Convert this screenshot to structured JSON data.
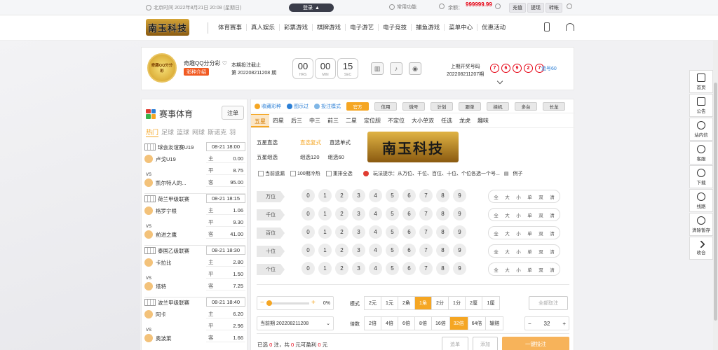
{
  "topbar": {
    "time": "北京时间 2022年8月21日 20:08 (星期日)",
    "login": "登录",
    "common_functions": "常用功能",
    "balance_label": "余额：",
    "balance_value": "999999.99",
    "btn_recharge": "充值",
    "btn_withdraw": "提现",
    "btn_transfer": "转帐"
  },
  "nav": {
    "logo": "南玉科技",
    "menu": [
      "体育赛事",
      "真人娱乐",
      "彩票游戏",
      "棋牌游戏",
      "电子游艺",
      "电子竞技",
      "捕鱼游戏",
      "菜单中心",
      "优惠活动"
    ]
  },
  "game": {
    "logo_text": "奇趣QQ分分彩",
    "name": "奇趣QQ分分彩",
    "intro_btn": "彩种介绍",
    "deadline_label": "本期投注截止",
    "period": "第 202208211208 期",
    "timers": [
      {
        "value": "00",
        "label": "HRS"
      },
      {
        "value": "00",
        "label": "MIN"
      },
      {
        "value": "15",
        "label": "SEC"
      }
    ],
    "last_label": "上期开奖号码",
    "last_period": "202208211207期",
    "last_numbers": [
      "7",
      "6",
      "9",
      "2",
      "7"
    ],
    "track": "追号60"
  },
  "sports": {
    "title": "赛事体育",
    "bet_btn": "注单",
    "tabs": [
      "热门",
      "足球",
      "篮球",
      "网球",
      "斯诺克",
      "羽"
    ],
    "vs": "VS",
    "matches": [
      {
        "league": "球会友谊赛U19",
        "time": "08-21 18:00",
        "home": "卢戈U19",
        "away": "凯尔特人的...",
        "odds": [
          [
            "主",
            "0.00"
          ],
          [
            "平",
            "8.75"
          ],
          [
            "客",
            "95.00"
          ]
        ]
      },
      {
        "league": "荷兰甲级联赛",
        "time": "08-21 18:15",
        "home": "格罗宁根",
        "away": "前进之鹰",
        "odds": [
          [
            "主",
            "1.06"
          ],
          [
            "平",
            "9.30"
          ],
          [
            "客",
            "41.00"
          ]
        ]
      },
      {
        "league": "泰国乙级联赛",
        "time": "08-21 18:30",
        "home": "卡拉比",
        "away": "塔特",
        "odds": [
          [
            "主",
            "2.80"
          ],
          [
            "平",
            "1.50"
          ],
          [
            "客",
            "7.25"
          ]
        ]
      },
      {
        "league": "波兰甲级联赛",
        "time": "08-21 18:40",
        "home": "阿卡",
        "away": "奥波莱",
        "odds": [
          [
            "主",
            "6.20"
          ],
          [
            "平",
            "2.96"
          ],
          [
            "客",
            "1.66"
          ]
        ]
      }
    ]
  },
  "betting": {
    "links": [
      "收藏彩种",
      "图示过",
      "投注模式"
    ],
    "modes": [
      "官方",
      "信用",
      "微号",
      "计划",
      "跟单",
      "挂机",
      "多台",
      "长龙"
    ],
    "tabs": [
      "五星",
      "四星",
      "后三",
      "中三",
      "前三",
      "二星",
      "定位胆",
      "不定位",
      "大小单双",
      "任选",
      "龙虎",
      "趣味"
    ],
    "play_rows": [
      {
        "group": "五星直选",
        "items": [
          "直选复式",
          "直选单式"
        ]
      },
      {
        "group": "五星组选",
        "items": [
          "组选120",
          "组选60"
        ]
      }
    ],
    "banner": "南玉科技",
    "options": [
      "当前遗漏",
      "100期冷热",
      "重排全选"
    ],
    "hint": "玩法提示：从万位、千位、百位、十位、个位各选一个号...",
    "example": "例子",
    "positions": [
      "万位",
      "千位",
      "百位",
      "十位",
      "个位"
    ],
    "digits": [
      "0",
      "1",
      "2",
      "3",
      "4",
      "5",
      "6",
      "7",
      "8",
      "9"
    ],
    "quick": [
      "全",
      "大",
      "小",
      "单",
      "双",
      "清"
    ],
    "slider_pct": "0%",
    "mode_label": "模式",
    "units": [
      "2元",
      "1元",
      "2角",
      "1角",
      "2分",
      "1分",
      "2厘",
      "1厘"
    ],
    "clear": "全部取注",
    "current_period": "当前期 202208211208",
    "multiple_label": "倍数",
    "multiples": [
      "2倍",
      "4倍",
      "6倍",
      "8倍",
      "16倍",
      "32倍",
      "64倍",
      "输赔"
    ],
    "stepper_value": "32",
    "summary": {
      "prefix": "已选",
      "count": "0",
      "unit": "注，共",
      "amount": "0",
      "mid": "元可盈利",
      "profit": "0",
      "suffix": "元"
    },
    "btn_track": "追单",
    "btn_add": "添加",
    "btn_bet": "一键投注"
  },
  "sidebar": [
    "首页",
    "公告",
    "站内信",
    "客服",
    "下载",
    "线路",
    "清除暂存",
    "收合"
  ],
  "colors": {
    "accent": "#f5a623",
    "red": "#e60012",
    "link": "#2b7fd6"
  }
}
